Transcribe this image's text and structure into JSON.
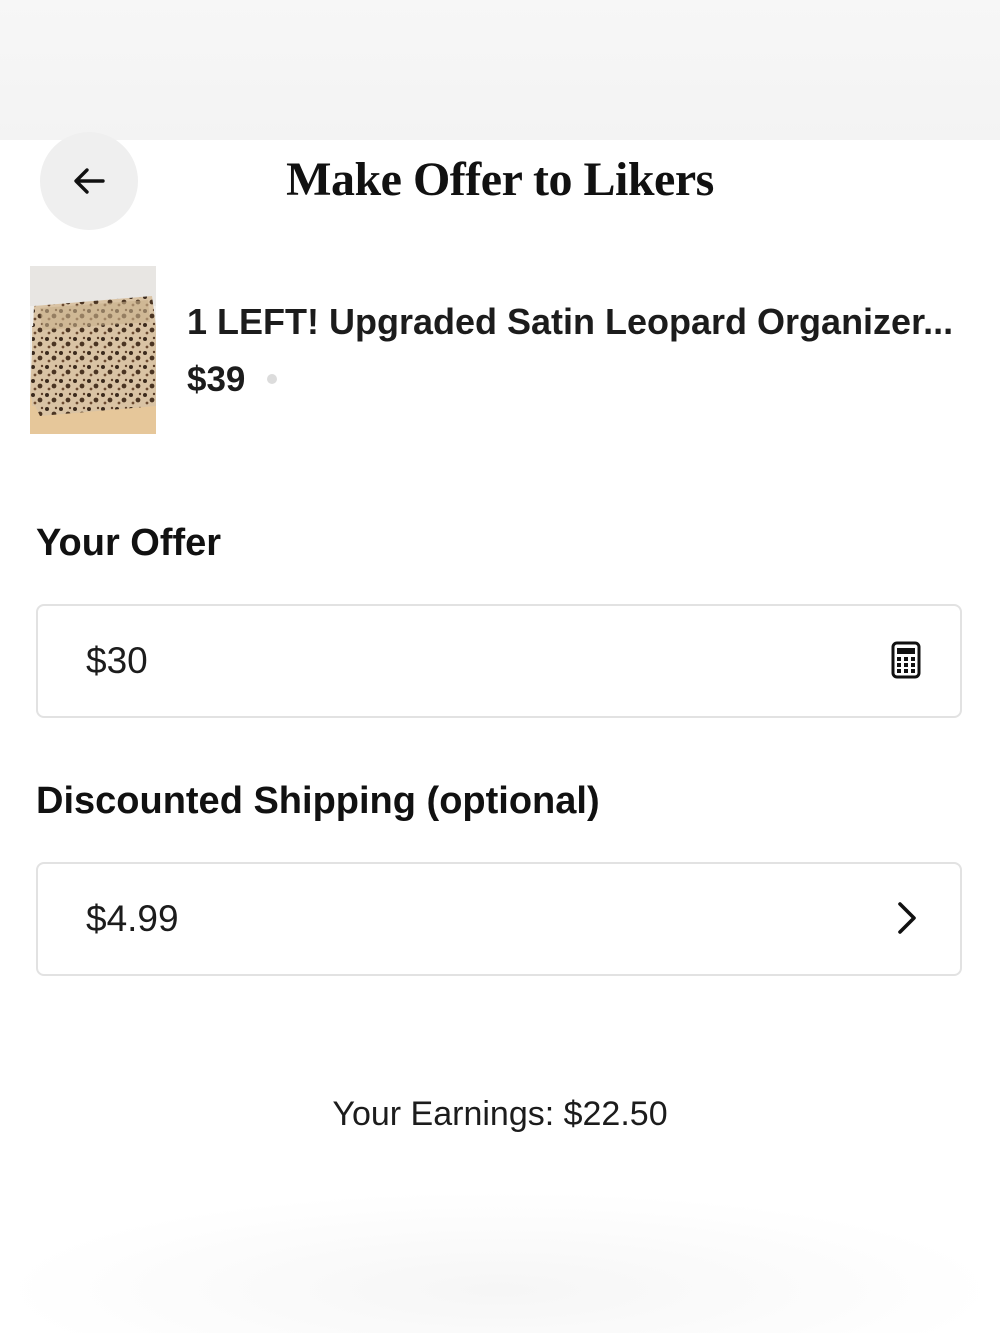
{
  "header": {
    "title": "Make Offer to Likers",
    "back_icon": "arrow-left-icon"
  },
  "product": {
    "title": "1 LEFT! Upgraded Satin Leopard Organizer...",
    "price": "$39",
    "thumbnail_icon": "leopard-organizer-thumbnail"
  },
  "offer": {
    "label": "Your Offer",
    "value": "$30",
    "icon": "calculator-icon"
  },
  "shipping": {
    "label": "Discounted Shipping (optional)",
    "value": "$4.99",
    "icon": "chevron-right-icon"
  },
  "earnings": {
    "text": "Your Earnings: $22.50"
  },
  "colors": {
    "text": "#1a1a1a",
    "field_border": "#e2e2e2",
    "back_button_bg": "#efefef"
  }
}
